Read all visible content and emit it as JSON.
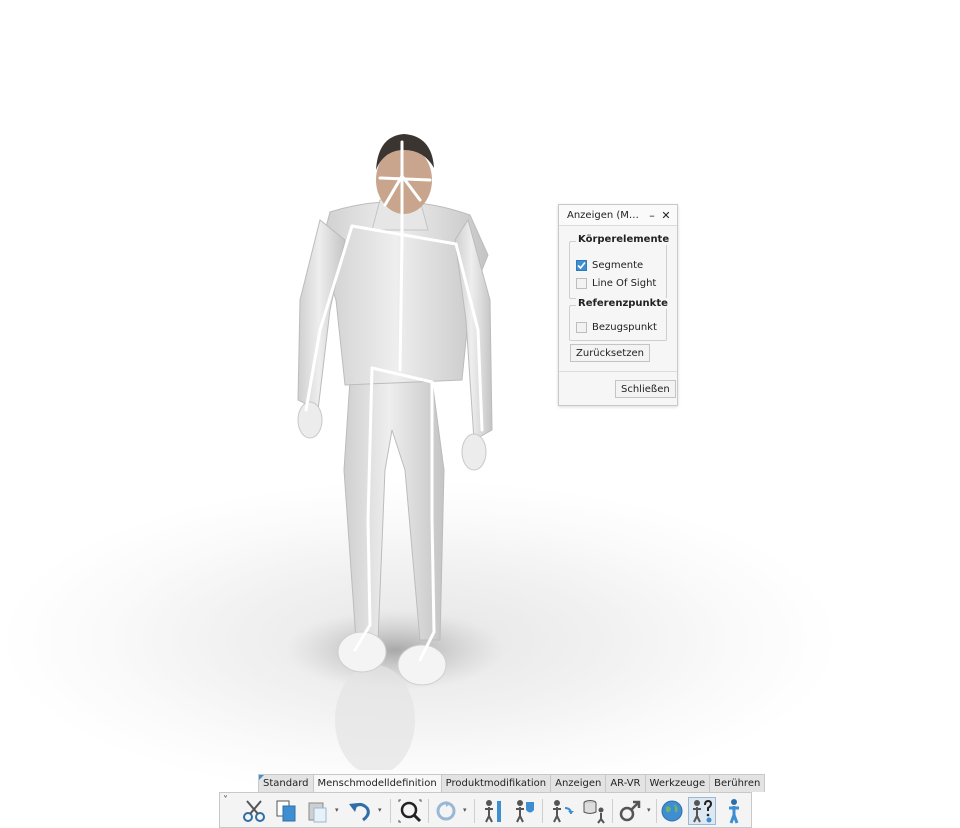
{
  "dialog": {
    "title": "Anzeigen (Men...",
    "minimize_glyph": "–",
    "close_glyph": "✕",
    "group1": {
      "legend": "Körperelemente",
      "items": [
        {
          "label": "Segmente",
          "checked": true
        },
        {
          "label": "Line Of Sight",
          "checked": false
        }
      ]
    },
    "group2": {
      "legend": "Referenzpunkte",
      "items": [
        {
          "label": "Bezugspunkt",
          "checked": false
        }
      ]
    },
    "reset_label": "Zurücksetzen",
    "close_label": "Schließen"
  },
  "ribbon": {
    "tabs": [
      "Standard",
      "Menschmodelldefinition",
      "Produktmodifikation",
      "Anzeigen",
      "AR-VR",
      "Werkzeuge",
      "Berühren"
    ],
    "active_tab": "Menschmodelldefinition",
    "collapse_glyph": "˅",
    "dropdown_glyph": "▾"
  },
  "tools": [
    "cut-icon",
    "copy-icon",
    "paste-icon",
    "undo-icon",
    "zoom-fit-icon",
    "refresh-icon",
    "manikin-measure-icon",
    "manikin-shield-icon",
    "manikin-update-icon",
    "database-manikin-icon",
    "gender-icon",
    "globe-icon",
    "manikin-help-icon",
    "manikin-standing-icon"
  ],
  "colors": {
    "accent": "#3d8fd1",
    "skeleton": "#ffffff",
    "suit": "#dcdcdc",
    "hair": "#3a3530"
  }
}
